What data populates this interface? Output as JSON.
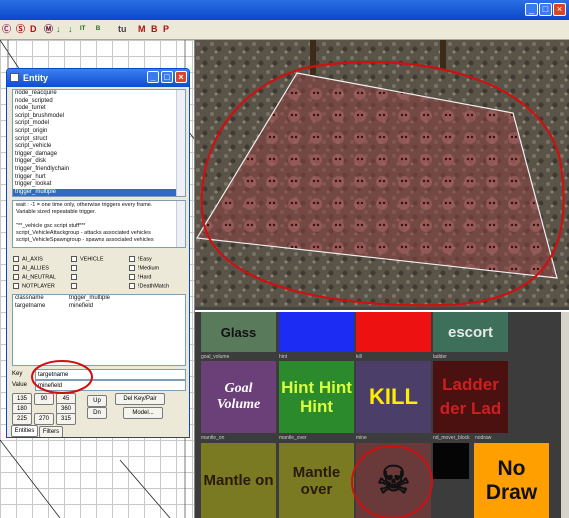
{
  "window": {
    "minimize_glyph": "_",
    "maximize_glyph": "□",
    "close_glyph": "×"
  },
  "toolbar": {
    "buttons": [
      "Ⓒ",
      "Ⓢ",
      "D",
      "Ⓜ",
      "↓",
      "↓",
      "ᴵᵀ",
      "ᴮ",
      "tu",
      "M",
      "B",
      "P"
    ]
  },
  "entity_window": {
    "title": "Entity",
    "classlist": [
      "node_reacquire",
      "node_scripted",
      "node_turret",
      "script_brushmodel",
      "script_model",
      "script_origin",
      "script_struct",
      "script_vehicle",
      "trigger_damage",
      "trigger_disk",
      "trigger_friendlychain",
      "trigger_hurt",
      "trigger_lookat",
      "trigger_multiple"
    ],
    "selected_class": "trigger_multiple",
    "description": [
      "wait : -1 = one time only, otherwise triggers every frame.",
      "Variable sized repeatable trigger.",
      "",
      "\"**_vehicle gsc script stuff***",
      "script_VehicleAttackgroup - attacks associated vehicles",
      "script_VehicleSpawngroup - spawns associated vehicles"
    ],
    "spawnflags": [
      {
        "label": "AI_AXIS",
        "col": 0
      },
      {
        "label": "VEHICLE",
        "col": 1
      },
      {
        "label": "!Easy",
        "col": 2
      },
      {
        "label": "AI_ALLIES",
        "col": 0
      },
      {
        "label": "",
        "col": 1
      },
      {
        "label": "!Medium",
        "col": 2
      },
      {
        "label": "AI_NEUTRAL",
        "col": 0
      },
      {
        "label": "",
        "col": 1
      },
      {
        "label": "!Hard",
        "col": 2
      },
      {
        "label": "NOTPLAYER",
        "col": 0
      },
      {
        "label": "",
        "col": 1
      },
      {
        "label": "!DeathMatch",
        "col": 2
      }
    ],
    "keyvalues": [
      {
        "key": "classname",
        "value": "trigger_multiple"
      },
      {
        "key": "targetname",
        "value": "minefield"
      }
    ],
    "key_label": "Key",
    "value_label": "Value",
    "key_input": "targetname",
    "value_input": "minefield",
    "angle_buttons": [
      "135",
      "90",
      "45",
      "180",
      "",
      "360",
      "225",
      "270",
      "315"
    ],
    "up_label": "Up",
    "dn_label": "Dn",
    "del_label": "Del Key/Pair",
    "model_label": "Model...",
    "tabs": [
      "Entities",
      "Filters"
    ]
  },
  "textures": {
    "top_row": [
      {
        "text": "Glass",
        "color": "#5a7a5c",
        "fg": "#111"
      },
      {
        "text": "",
        "color": "#1d2cf2",
        "fg": "#fff"
      },
      {
        "text": "",
        "color": "#ee1111",
        "fg": "#fff"
      },
      {
        "text": "escort",
        "color": "#3d6f5a",
        "fg": "#e8e8e8"
      }
    ],
    "mid_labels": [
      "goal_volume",
      "hint",
      "kill",
      "ladder"
    ],
    "mid_row": [
      {
        "text": "Goal Volume",
        "color": "#6b3f78",
        "fg": "#fff"
      },
      {
        "text": "Hint Hint Hint",
        "color": "#2b8a2b",
        "fg": "#d8ff40"
      },
      {
        "text": "KILL",
        "color": "#4b3f6a",
        "fg": "#ffee00"
      },
      {
        "text": "Ladder der Lad",
        "color": "#4b1010",
        "fg": "#cc2020"
      }
    ],
    "bot_labels": [
      "mantle_on",
      "mantle_over",
      "mine",
      "nd_mover_block",
      "nodraw"
    ],
    "bot_row": [
      {
        "text": "Mantle on",
        "color": "#7a7a22",
        "fg": "#2a1a0a"
      },
      {
        "text": "Mantle over",
        "color": "#7a7a22",
        "fg": "#2a1a0a"
      },
      {
        "text": "☠",
        "color": "#6a3a3a",
        "fg": "#111"
      },
      {
        "text": "",
        "color": "#050505",
        "fg": "#fff"
      },
      {
        "text": "No Draw",
        "color": "#ffa000",
        "fg": "#111"
      }
    ]
  }
}
